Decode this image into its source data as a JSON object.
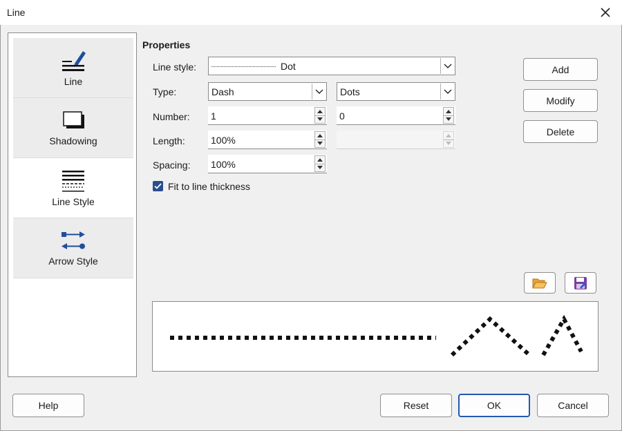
{
  "window": {
    "title": "Line",
    "close_icon": "close-icon"
  },
  "tabs": [
    {
      "label": "Line",
      "icon": "line-pencil-icon",
      "active": false
    },
    {
      "label": "Shadowing",
      "icon": "shadow-box-icon",
      "active": false
    },
    {
      "label": "Line Style",
      "icon": "line-style-icon",
      "active": true
    },
    {
      "label": "Arrow Style",
      "icon": "arrow-style-icon",
      "active": false
    }
  ],
  "properties": {
    "title": "Properties",
    "line_style": {
      "label": "Line style:",
      "value": "Dot"
    },
    "type": {
      "label": "Type:",
      "value1": "Dash",
      "value2": "Dots"
    },
    "number": {
      "label": "Number:",
      "value1": "1",
      "value2": "0"
    },
    "length": {
      "label": "Length:",
      "value1": "100%",
      "value2": ""
    },
    "spacing": {
      "label": "Spacing:",
      "value": "100%"
    },
    "fit": {
      "label": "Fit to line thickness",
      "checked": true
    }
  },
  "side_buttons": {
    "add": "Add",
    "modify": "Modify",
    "delete": "Delete"
  },
  "file_buttons": {
    "open_icon": "folder-open-icon",
    "save_icon": "save-icon"
  },
  "footer": {
    "help": "Help",
    "reset": "Reset",
    "ok": "OK",
    "cancel": "Cancel"
  },
  "colors": {
    "accent": "#2457b0",
    "checkbox": "#2b4c8e",
    "tab_icon": "#1f4e9c"
  }
}
